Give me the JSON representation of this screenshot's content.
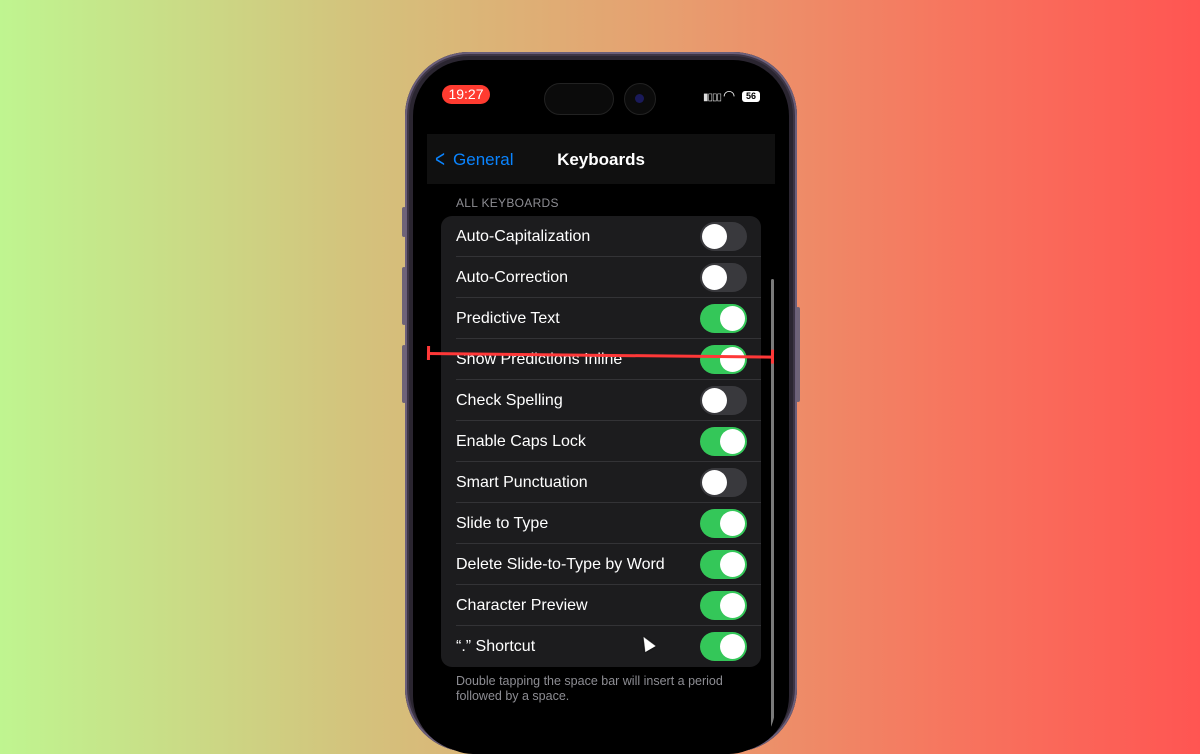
{
  "status_bar": {
    "time": "19:27",
    "battery": "56"
  },
  "nav": {
    "back_label": "General",
    "title": "Keyboards"
  },
  "section": {
    "header": "ALL KEYBOARDS",
    "rows": [
      {
        "label": "Auto-Capitalization",
        "on": false
      },
      {
        "label": "Auto-Correction",
        "on": false
      },
      {
        "label": "Predictive Text",
        "on": true
      },
      {
        "label": "Show Predictions Inline",
        "on": true
      },
      {
        "label": "Check Spelling",
        "on": false
      },
      {
        "label": "Enable Caps Lock",
        "on": true
      },
      {
        "label": "Smart Punctuation",
        "on": false
      },
      {
        "label": "Slide to Type",
        "on": true
      },
      {
        "label": "Delete Slide-to-Type by Word",
        "on": true
      },
      {
        "label": "Character Preview",
        "on": true
      },
      {
        "label": "“.” Shortcut",
        "on": true
      }
    ],
    "footer": "Double tapping the space bar will insert a period followed by a space."
  },
  "colors": {
    "toggle_on": "#34c759",
    "link": "#0a84ff",
    "annotation": "#ff3838"
  }
}
